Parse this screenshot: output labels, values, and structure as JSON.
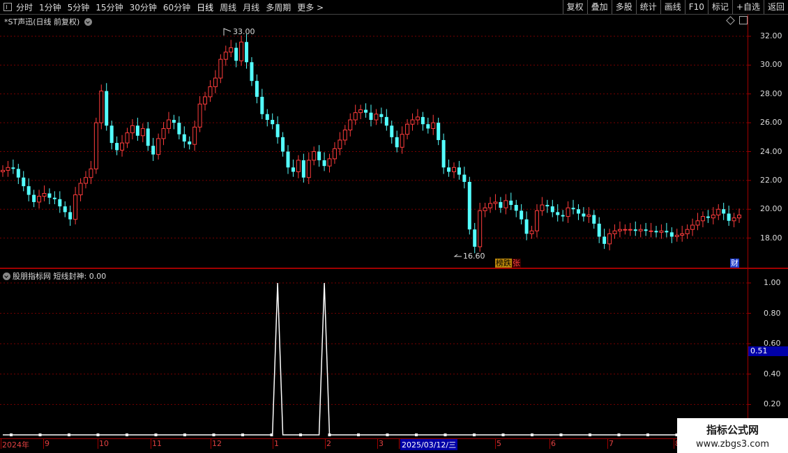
{
  "toolbar": {
    "periods": [
      "分时",
      "1分钟",
      "5分钟",
      "15分钟",
      "30分钟",
      "60分钟",
      "日线",
      "周线",
      "月线",
      "多周期",
      "更多 >"
    ],
    "active_period": "日线",
    "right_buttons": [
      "复权",
      "叠加",
      "多股",
      "统计",
      "画线",
      "F10",
      "标记",
      "+自选",
      "返回"
    ]
  },
  "main_panel": {
    "title": "*ST声迅(日线 前复权)",
    "high_label": "33.00",
    "low_label": "16.60",
    "badge_left": "榜跌",
    "badge_right": "张",
    "badge_cai": "财",
    "price_axis": [
      "32.00",
      "30.00",
      "28.00",
      "26.00",
      "24.00",
      "22.00",
      "20.00",
      "18.00"
    ]
  },
  "indicator_panel": {
    "title": "股朋指标网 短线封神: 0.00",
    "axis": [
      "1.00",
      "0.80",
      "0.60",
      "0.40",
      "0.20"
    ],
    "current_value": "0.51"
  },
  "date_axis": {
    "labels": [
      "2024年",
      "9",
      "10",
      "11",
      "12",
      "1",
      "2",
      "3",
      "2025/03/12/三",
      "5",
      "6",
      "7",
      "8"
    ]
  },
  "watermark": {
    "line1": "指标公式网",
    "line2": "www.zbgs3.com"
  },
  "colors": {
    "up": "#ff3c3c",
    "down": "#54ffff",
    "frame": "#a00000",
    "signal_line": "#ffffff",
    "value_box": "#0000a8"
  },
  "chart_data": {
    "type": "candlestick",
    "ylim": [
      16,
      33.5
    ],
    "close_series": [
      22.7,
      22.9,
      22.8,
      22.2,
      21.6,
      21.0,
      20.5,
      20.9,
      21.1,
      20.8,
      20.7,
      20.2,
      19.8,
      19.3,
      21.0,
      21.8,
      22.2,
      22.8,
      26.0,
      28.2,
      25.8,
      24.6,
      24.1,
      24.6,
      25.3,
      25.8,
      25.1,
      25.6,
      24.4,
      23.8,
      24.9,
      25.6,
      26.2,
      26.0,
      25.2,
      24.7,
      24.5,
      25.7,
      27.3,
      27.8,
      28.5,
      29.1,
      30.4,
      30.9,
      31.2,
      30.3,
      31.6,
      30.2,
      28.9,
      27.8,
      26.6,
      26.2,
      25.9,
      25.0,
      24.0,
      22.9,
      22.6,
      23.4,
      22.2,
      23.4,
      24.0,
      23.4,
      23.0,
      23.5,
      24.2,
      24.8,
      25.5,
      26.2,
      26.7,
      26.9,
      26.7,
      26.2,
      26.6,
      26.4,
      25.8,
      25.0,
      24.3,
      25.2,
      25.9,
      26.2,
      26.4,
      25.9,
      25.6,
      26.0,
      24.8,
      22.9,
      22.6,
      22.9,
      22.4,
      21.9,
      18.6,
      17.4,
      19.9,
      20.1,
      20.4,
      20.5,
      20.1,
      20.6,
      20.3,
      19.9,
      19.3,
      18.3,
      18.5,
      19.9,
      20.3,
      20.2,
      19.8,
      19.6,
      19.5,
      20.1,
      20.0,
      19.7,
      19.5,
      19.6,
      19.0,
      18.1,
      17.6,
      18.3,
      18.5,
      18.6,
      18.6,
      18.6,
      18.5,
      18.6,
      18.5,
      18.5,
      18.4,
      18.5,
      18.4,
      18.1,
      18.2,
      18.3,
      18.6,
      18.9,
      19.2,
      19.5,
      19.4,
      19.6,
      20.0,
      19.7,
      19.2,
      19.4,
      19.6
    ],
    "indicator_series": {
      "name": "短线封神",
      "spikes_at_candle_index": [
        53,
        62
      ],
      "spike_value": 1.0,
      "baseline": 0.0
    }
  }
}
